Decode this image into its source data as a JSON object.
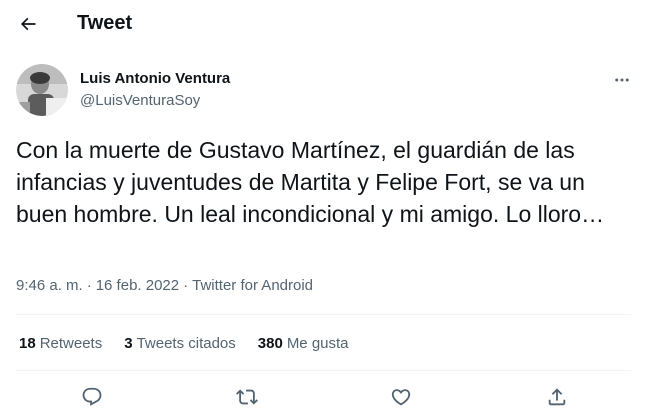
{
  "header": {
    "title": "Tweet",
    "back_icon": "arrow-left-icon"
  },
  "author": {
    "name": "Luis Antonio Ventura",
    "handle": "@LuisVenturaSoy",
    "more_icon": "more-horizontal-icon"
  },
  "tweet": {
    "text": "Con la muerte de Gustavo Martínez, el guardián de las infancias y juventudes de Martita y Felipe Fort, se va un buen hombre. Un leal incondicional y mi amigo. Lo lloro…",
    "time": "9:46 a. m.",
    "separator": "·",
    "date": "16 feb. 2022",
    "source": "Twitter for Android"
  },
  "stats": {
    "retweets_count": "18",
    "retweets_label": "Retweets",
    "quotes_count": "3",
    "quotes_label": "Tweets citados",
    "likes_count": "380",
    "likes_label": "Me gusta"
  },
  "actions": {
    "reply_icon": "reply-icon",
    "retweet_icon": "retweet-icon",
    "like_icon": "heart-icon",
    "share_icon": "share-icon"
  },
  "colors": {
    "text_primary": "#0f1419",
    "text_secondary": "#536471",
    "divider": "#eff3f4",
    "background": "#ffffff"
  }
}
